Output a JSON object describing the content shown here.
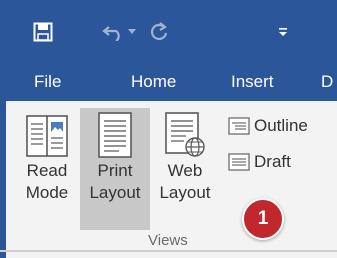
{
  "colors": {
    "ribbon_blue": "#2b579a",
    "ribbon_bg": "#f3f3f3",
    "selected_bg": "#c8c8c8",
    "badge_red": "#c0282d"
  },
  "quick_access": {
    "icons": [
      "save-icon",
      "undo-icon",
      "undo-dropdown-icon",
      "redo-icon",
      "customize-toolbar-icon"
    ]
  },
  "tabs": [
    {
      "label": "File"
    },
    {
      "label": "Home"
    },
    {
      "label": "Insert"
    },
    {
      "label": "D"
    }
  ],
  "views_group": {
    "label": "Views",
    "buttons": [
      {
        "line1": "Read",
        "line2": "Mode",
        "icon": "read-mode-icon",
        "selected": false
      },
      {
        "line1": "Print",
        "line2": "Layout",
        "icon": "print-layout-icon",
        "selected": true
      },
      {
        "line1": "Web",
        "line2": "Layout",
        "icon": "web-layout-icon",
        "selected": false
      }
    ],
    "small_buttons": [
      {
        "label": "Outline",
        "icon": "outline-icon"
      },
      {
        "label": "Draft",
        "icon": "draft-icon"
      }
    ]
  },
  "annotation": {
    "badge": "1"
  }
}
